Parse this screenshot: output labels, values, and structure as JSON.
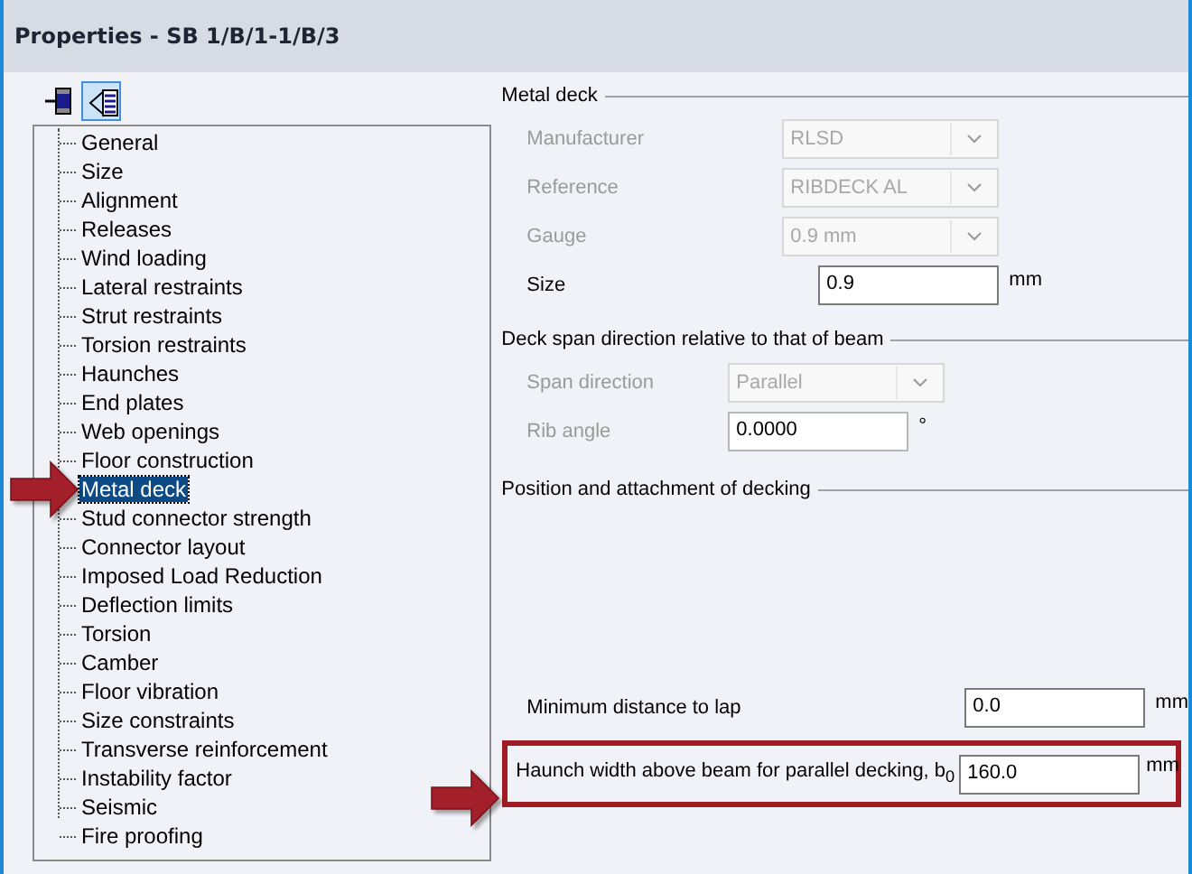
{
  "window": {
    "title": "Properties - SB 1/B/1-1/B/3"
  },
  "toolbar": [
    {
      "kind": "member",
      "selected": false
    },
    {
      "kind": "list",
      "selected": true
    }
  ],
  "tree": {
    "items": [
      {
        "label": "General",
        "selected": false
      },
      {
        "label": "Size",
        "selected": false
      },
      {
        "label": "Alignment",
        "selected": false
      },
      {
        "label": "Releases",
        "selected": false
      },
      {
        "label": "Wind loading",
        "selected": false
      },
      {
        "label": "Lateral restraints",
        "selected": false
      },
      {
        "label": "Strut restraints",
        "selected": false
      },
      {
        "label": "Torsion restraints",
        "selected": false
      },
      {
        "label": "Haunches",
        "selected": false
      },
      {
        "label": "End plates",
        "selected": false
      },
      {
        "label": "Web openings",
        "selected": false
      },
      {
        "label": "Floor construction",
        "selected": false
      },
      {
        "label": "Metal deck",
        "selected": true
      },
      {
        "label": "Stud connector strength",
        "selected": false
      },
      {
        "label": "Connector layout",
        "selected": false
      },
      {
        "label": "Imposed Load Reduction",
        "selected": false
      },
      {
        "label": "Deflection limits",
        "selected": false
      },
      {
        "label": "Torsion",
        "selected": false
      },
      {
        "label": "Camber",
        "selected": false
      },
      {
        "label": "Floor vibration",
        "selected": false
      },
      {
        "label": "Size constraints",
        "selected": false
      },
      {
        "label": "Transverse reinforcement",
        "selected": false
      },
      {
        "label": "Instability factor",
        "selected": false
      },
      {
        "label": "Seismic",
        "selected": false
      },
      {
        "label": "Fire proofing",
        "selected": false
      }
    ]
  },
  "sections": [
    {
      "title": "Metal deck",
      "fields": [
        {
          "label": "Manufacturer",
          "kind": "combo",
          "value": "RLSD",
          "disabled": true,
          "highlighted": false
        },
        {
          "label": "Reference",
          "kind": "combo",
          "value": "RIBDECK AL",
          "disabled": true,
          "highlighted": false
        },
        {
          "label": "Gauge",
          "kind": "combo",
          "value": "0.9 mm",
          "disabled": true,
          "highlighted": false
        },
        {
          "label": "Size",
          "kind": "text",
          "value": "0.9",
          "unit": "mm",
          "disabled": false,
          "highlighted": false
        }
      ]
    },
    {
      "title": "Deck span direction relative to that of beam",
      "fields": [
        {
          "label": "Span direction",
          "kind": "combo",
          "value": "Parallel",
          "disabled": true,
          "highlighted": false
        },
        {
          "label": "Rib angle",
          "kind": "text",
          "value": "0.0000",
          "unit": "°",
          "disabled": true,
          "highlighted": false
        }
      ]
    },
    {
      "title": "Position and attachment of decking",
      "fields": [
        {
          "label": "Minimum distance to lap",
          "kind": "text",
          "value": "0.0",
          "unit": "mm",
          "disabled": false,
          "highlighted": false
        },
        {
          "label": "Haunch width above beam for parallel decking, b$_{0}$",
          "kind": "text",
          "value": "160.0",
          "unit": "mm",
          "disabled": false,
          "highlighted": true
        }
      ]
    }
  ],
  "callouts": [
    {
      "kind": "arrow"
    },
    {
      "kind": "arrow"
    }
  ]
}
